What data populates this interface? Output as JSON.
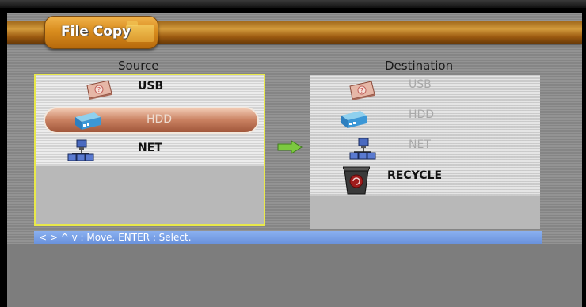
{
  "window": {
    "title": "File Copy"
  },
  "source": {
    "heading": "Source",
    "items": [
      {
        "label": "USB",
        "icon": "usb-drive-icon"
      },
      {
        "label": "HDD",
        "icon": "hard-disk-icon"
      },
      {
        "label": "NET",
        "icon": "network-icon"
      }
    ],
    "selected": "HDD"
  },
  "destination": {
    "heading": "Destination",
    "items": [
      {
        "label": "USB",
        "icon": "usb-drive-icon"
      },
      {
        "label": "HDD",
        "icon": "hard-disk-icon"
      },
      {
        "label": "NET",
        "icon": "network-icon"
      },
      {
        "label": "RECYCLE",
        "icon": "recycle-bin-icon"
      }
    ]
  },
  "help": {
    "text": "< > ^ v : Move. ENTER : Select."
  },
  "colors": {
    "title_bar": "#c8861e",
    "panel": "#8c8c8c",
    "selection": "#c98060",
    "focus_border": "#e8e84a",
    "status_bar": "#7aa2e8",
    "arrow": "#7cc840"
  }
}
